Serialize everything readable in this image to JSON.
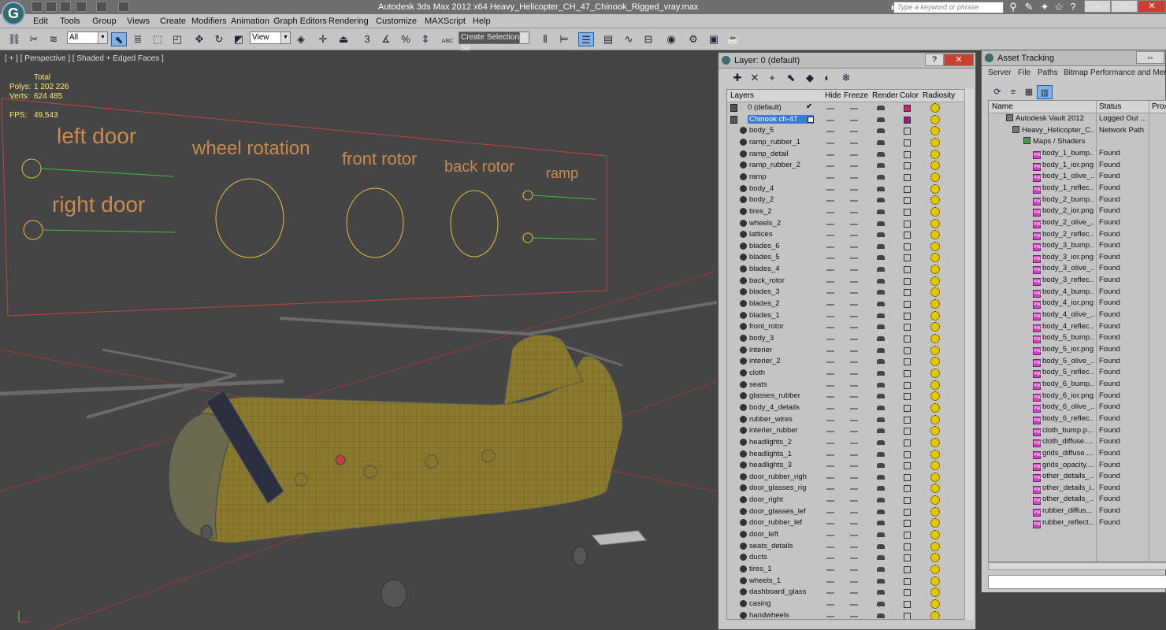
{
  "app": {
    "title": "Autodesk 3ds Max  2012 x64      Heavy_Helicopter_CH_47_Chinook_Rigged_vray.max",
    "search_placeholder": "Type a keyword or phrase",
    "logo_letter": "G"
  },
  "menu": [
    "Edit",
    "Tools",
    "Group",
    "Views",
    "Create",
    "Modifiers",
    "Animation",
    "Graph Editors",
    "Rendering",
    "Customize",
    "MAXScript",
    "Help"
  ],
  "toolbar": {
    "filter_value": "All",
    "refcoord_value": "View",
    "selection_set_value": "Create Selection Se",
    "snap_3": "3",
    "percent": "%",
    "abc": "ABC"
  },
  "viewport": {
    "label": "[ + ] [ Perspective ] [ Shaded + Edged Faces ]",
    "stats": {
      "total_label": "Total",
      "polys_label": "Polys:",
      "polys_value": "1 202 226",
      "verts_label": "Verts:",
      "verts_value": "624 485",
      "fps_label": "FPS:",
      "fps_value": "49,543"
    },
    "controls": {
      "left_door": "left door",
      "right_door": "right door",
      "wheel_rotation": "wheel rotation",
      "front_rotor": "front rotor",
      "back_rotor": "back rotor",
      "ramp": "ramp"
    }
  },
  "layer_window": {
    "title": "Layer: 0 (default)",
    "columns": [
      "Layers",
      "Hide",
      "Freeze",
      "Render",
      "Color",
      "Radiosity"
    ],
    "default_layer": "0 (default)",
    "selected_layer": "Chinook ch-47",
    "objects": [
      "body_5",
      "ramp_rubber_1",
      "ramp_detail",
      "ramp_rubber_2",
      "ramp",
      "body_4",
      "body_2",
      "tires_2",
      "wheels_2",
      "lattices",
      "blades_6",
      "blades_5",
      "blades_4",
      "back_rotor",
      "blades_3",
      "blades_2",
      "blades_1",
      "front_rotor",
      "body_3",
      "interier",
      "interier_2",
      "cloth",
      "seats",
      "glasses_rubber",
      "body_4_details",
      "rubber_wires",
      "interier_rubber",
      "headlights_2",
      "headlights_1",
      "headlights_3",
      "door_rubber_righ",
      "door_glasses_rig",
      "door_right",
      "door_glasses_lef",
      "door_rubber_lef",
      "door_left",
      "seats_details",
      "ducts",
      "tires_1",
      "wheels_1",
      "dashboard_glass",
      "casing",
      "handwheels"
    ],
    "colors": {
      "default_swatch": "#d0206a",
      "selected_swatch": "#9a1a8a",
      "selection": "#3a7bd5"
    }
  },
  "asset_window": {
    "title": "Asset Tracking",
    "menu": [
      "Server",
      "File",
      "Paths",
      "Bitmap Performance and Memo"
    ],
    "columns": [
      "Name",
      "Status",
      "Prox"
    ],
    "vault": {
      "name": "Autodesk Vault 2012",
      "status": "Logged Out ..."
    },
    "scene_file": {
      "name": "Heavy_Helicopter_C...",
      "status": "Network Path"
    },
    "maps_group": "Maps / Shaders",
    "maps": [
      {
        "name": "body_1_bump...",
        "status": "Found"
      },
      {
        "name": "body_1_ior.png",
        "status": "Found"
      },
      {
        "name": "body_1_olive_...",
        "status": "Found"
      },
      {
        "name": "body_1_reflec...",
        "status": "Found"
      },
      {
        "name": "body_2_bump...",
        "status": "Found"
      },
      {
        "name": "body_2_ior.png",
        "status": "Found"
      },
      {
        "name": "body_2_olive_...",
        "status": "Found"
      },
      {
        "name": "body_2_reflec...",
        "status": "Found"
      },
      {
        "name": "body_3_bump...",
        "status": "Found"
      },
      {
        "name": "body_3_ior.png",
        "status": "Found"
      },
      {
        "name": "body_3_olive_...",
        "status": "Found"
      },
      {
        "name": "body_3_reflec...",
        "status": "Found"
      },
      {
        "name": "body_4_bump...",
        "status": "Found"
      },
      {
        "name": "body_4_ior.png",
        "status": "Found"
      },
      {
        "name": "body_4_olive_...",
        "status": "Found"
      },
      {
        "name": "body_4_reflec...",
        "status": "Found"
      },
      {
        "name": "body_5_bump...",
        "status": "Found"
      },
      {
        "name": "body_5_ior.png",
        "status": "Found"
      },
      {
        "name": "body_5_olive_...",
        "status": "Found"
      },
      {
        "name": "body_5_reflec...",
        "status": "Found"
      },
      {
        "name": "body_6_bump...",
        "status": "Found"
      },
      {
        "name": "body_6_ior.png",
        "status": "Found"
      },
      {
        "name": "body_6_olive_...",
        "status": "Found"
      },
      {
        "name": "body_6_reflec...",
        "status": "Found"
      },
      {
        "name": "cloth_bump.p...",
        "status": "Found"
      },
      {
        "name": "cloth_diffuse....",
        "status": "Found"
      },
      {
        "name": "grids_diffuse....",
        "status": "Found"
      },
      {
        "name": "grids_opacity....",
        "status": "Found"
      },
      {
        "name": "other_details_...",
        "status": "Found"
      },
      {
        "name": "other_details_i...",
        "status": "Found"
      },
      {
        "name": "other_details_...",
        "status": "Found"
      },
      {
        "name": "rubber_diffus...",
        "status": "Found"
      },
      {
        "name": "rubber_reflect...",
        "status": "Found"
      }
    ]
  }
}
